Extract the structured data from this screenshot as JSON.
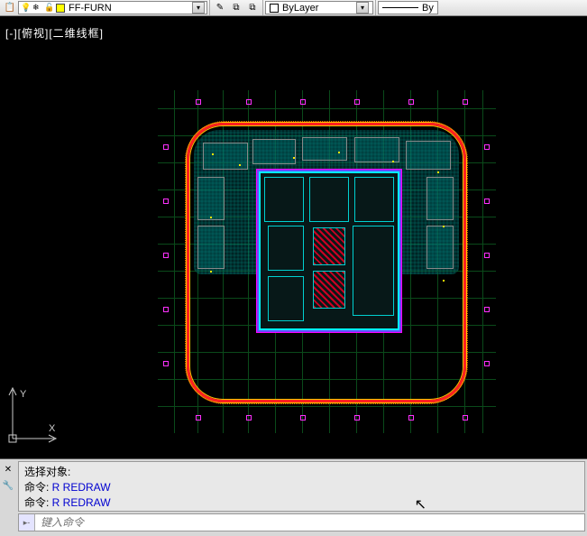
{
  "toolbar": {
    "layer": {
      "name": "FF-FURN",
      "color": "#ffff00"
    },
    "bylayer_label": "ByLayer",
    "line_label": "By"
  },
  "viewport": {
    "label": "[-][俯视][二维线框]",
    "ucs": {
      "x_label": "X",
      "y_label": "Y"
    }
  },
  "command": {
    "history": [
      {
        "prefix": "选择对象:",
        "cmd": ""
      },
      {
        "prefix": "命令: ",
        "cmd": "R REDRAW"
      },
      {
        "prefix": "命令: ",
        "cmd": "R REDRAW"
      }
    ],
    "input_placeholder": "键入命令"
  }
}
